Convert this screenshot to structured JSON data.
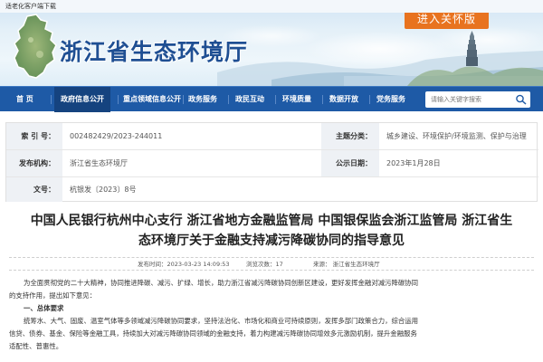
{
  "topbar": {
    "aging_link": "适老化客户端下载"
  },
  "header": {
    "site_title": "浙江省生态环境厅",
    "care_button": "进入关怀版"
  },
  "nav": {
    "items": [
      {
        "label": "首  页"
      },
      {
        "label": "政府信息公开"
      },
      {
        "label": "重点领域信息公开"
      },
      {
        "label": "政务服务"
      },
      {
        "label": "政民互动"
      },
      {
        "label": "环境质量"
      },
      {
        "label": "数据开放"
      },
      {
        "label": "党务服务"
      }
    ],
    "search_placeholder": "请输入关键字搜索"
  },
  "meta": {
    "index_label": "索 引 号：",
    "index_value": "002482429/2023-244011",
    "category_label": "主题分类：",
    "category_value": "城乡建设、环境保护/环境监测、保护与治理",
    "publisher_label": "发布机构：",
    "publisher_value": "浙江省生态环境厅",
    "date_label": "公示日期：",
    "date_value": "2023年1月28日",
    "docno_label": "文号：",
    "docno_value": "杭银发〔2023〕8号"
  },
  "article": {
    "title_line1": "中国人民银行杭州中心支行  浙江省地方金融监管局  中国银保监会浙江监管局  浙江省生",
    "title_line2": "态环境厅关于金融支持减污降碳协同的指导意见",
    "publish_time": "发布时间：2023-03-23 14:09:53",
    "views": "浏览次数：17",
    "source": "来源：  浙江省生态环境厅",
    "paragraphs": [
      "为全面贯彻党的二十大精神，协同推进降碳、减污、扩绿、增长，助力浙江省减污降碳协同创新区建设，更好发挥金融对减污降碳协同",
      "的支持作用，提出如下意见："
    ],
    "section1_heading": "一、总体要求",
    "section1_paragraphs": [
      "统筹水、大气、固废、温室气体等多领域减污降碳协同要求，坚持法治化、市场化和商业可持续原则，发挥多部门政策合力，综合运用",
      "信贷、债券、基金、保险等金融工具，持续加大对减污降碳协同领域的金融支持，着力构建减污降碳协同增效多元激励机制，提升金融服务",
      "适配性、普惠性。"
    ]
  },
  "colors": {
    "nav_bg": "#1e5aa6",
    "nav_active": "#15437f",
    "title_blue": "#1f4f93",
    "care_orange": "#e8731f"
  }
}
